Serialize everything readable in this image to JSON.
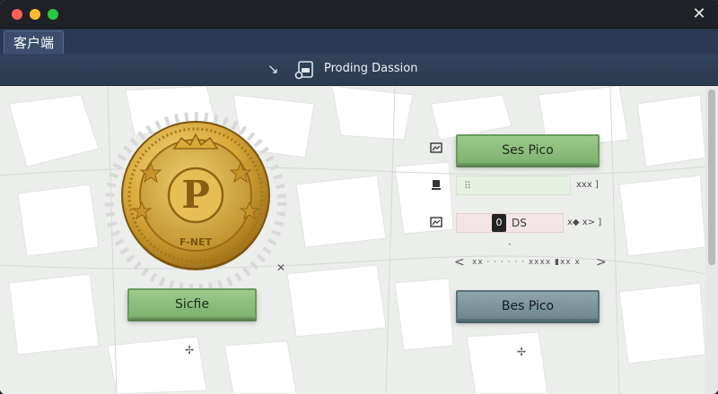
{
  "window": {
    "close_glyph": "✕"
  },
  "tab": {
    "label": "客户端"
  },
  "nav": {
    "title": "Proding Dassion",
    "arrow_icon": "arrow-down-right-icon",
    "doc_icon": "document-icon"
  },
  "coin": {
    "letter": "P",
    "caption": "F-NET"
  },
  "buttons": {
    "signin": "Sicfie",
    "ses_pico": "Ses Pico",
    "bes_pico": "Bes Pico"
  },
  "form": {
    "row1_value": "⠿",
    "row1_tail": "xxx ]",
    "row2_badge": "0",
    "row2_label": "DS",
    "row2_tail": "x◆ x> ]",
    "pager_left": "<",
    "pager_text": "xx  ·  ·  ·  ·  ·  ·  xxxx ▮xx   x",
    "pager_right": ">"
  },
  "colors": {
    "accent_green": "#7fb16f",
    "accent_slate": "#6e878d",
    "header_bg": "#2c3a51",
    "coin_gold": "#d9a93a"
  }
}
